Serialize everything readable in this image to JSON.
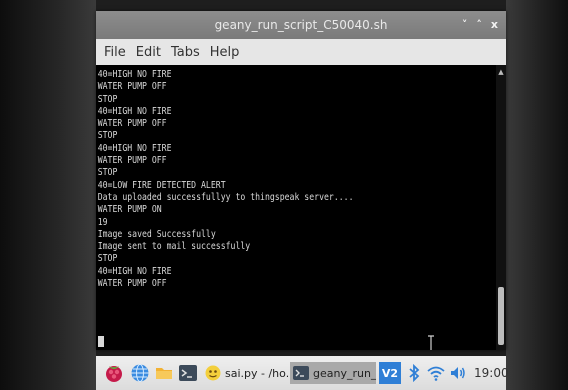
{
  "window": {
    "title": "geany_run_script_C50040.sh",
    "controls": {
      "minimize": "˅",
      "maximize": "˄",
      "close": "x"
    }
  },
  "menu": [
    "File",
    "Edit",
    "Tabs",
    "Help"
  ],
  "terminal": {
    "lines": [
      "40=HIGH NO FIRE",
      "WATER PUMP OFF",
      "STOP",
      "40=HIGH NO FIRE",
      "WATER PUMP OFF",
      "STOP",
      "40=HIGH NO FIRE",
      "WATER PUMP OFF",
      "STOP",
      "40=LOW FIRE DETECTED ALERT",
      "Data uploaded successfullyy to thingspeak server....",
      "WATER PUMP ON",
      "19",
      "Image saved Successfully",
      "Image sent to mail successfully",
      "STOP",
      "40=HIGH NO FIRE",
      "WATER PUMP OFF"
    ]
  },
  "taskbar": {
    "tasks": [
      {
        "label": "sai.py - /ho...",
        "icon": "python-icon"
      },
      {
        "label": "geany_run_...",
        "icon": "terminal-icon"
      }
    ],
    "vnc_label": "V2",
    "clock": "19:00"
  },
  "colors": {
    "titlebar": "#7f7f7f",
    "menubar": "#e6e6e6",
    "terminal_bg": "#000000",
    "terminal_fg": "#d8d8d8",
    "taskbar": "#e4e4e4",
    "accent_blue": "#2f7fd6"
  }
}
